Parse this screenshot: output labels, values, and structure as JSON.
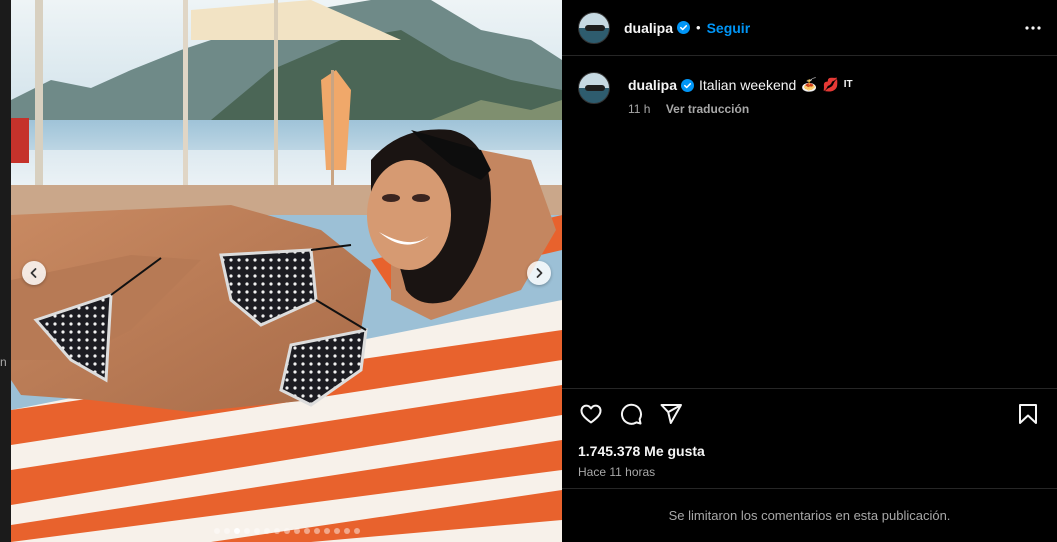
{
  "post": {
    "username": "dualipa",
    "follow_label": "Seguir",
    "separator": "•",
    "caption": "Italian weekend",
    "caption_emojis": [
      "🍝",
      "💋",
      "IT"
    ],
    "age": "11 h",
    "translate_label": "Ver traducción",
    "likes": "1.745.378 Me gusta",
    "posted_ago": "Hace 11 horas",
    "comments_notice": "Se limitaron los comentarios en esta publicación."
  },
  "background_peek_text": "n",
  "carousel": {
    "total_slides": 15,
    "active_index": 2
  },
  "icons": {
    "verified": "verified-badge-icon",
    "more": "more-options-icon",
    "like": "heart-icon",
    "comment": "comment-icon",
    "share": "send-icon",
    "save": "bookmark-icon",
    "prev": "chevron-left-icon",
    "next": "chevron-right-icon"
  },
  "colors": {
    "accent": "#0095f6",
    "background": "#000000",
    "muted": "#a8a8a8",
    "towel_orange": "#e8622d"
  }
}
